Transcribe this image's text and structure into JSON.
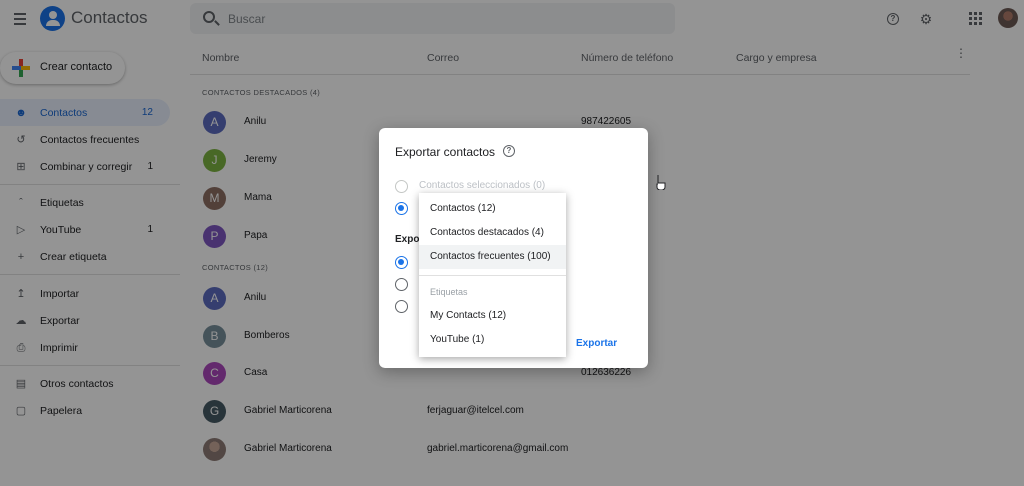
{
  "app": {
    "title": "Contactos"
  },
  "search": {
    "placeholder": "Buscar"
  },
  "sidebar": {
    "create_label": "Crear contacto",
    "items": [
      {
        "label": "Contactos",
        "count": "12"
      },
      {
        "label": "Contactos frecuentes",
        "count": ""
      },
      {
        "label": "Combinar y corregir",
        "count": "1"
      },
      {
        "label": "Etiquetas",
        "count": ""
      },
      {
        "label": "YouTube",
        "count": "1"
      },
      {
        "label": "Crear etiqueta",
        "count": ""
      },
      {
        "label": "Importar",
        "count": ""
      },
      {
        "label": "Exportar",
        "count": ""
      },
      {
        "label": "Imprimir",
        "count": ""
      },
      {
        "label": "Otros contactos",
        "count": ""
      },
      {
        "label": "Papelera",
        "count": ""
      }
    ]
  },
  "table": {
    "headers": [
      "Nombre",
      "Correo",
      "Número de teléfono",
      "Cargo y empresa"
    ],
    "starred_label": "CONTACTOS DESTACADOS (4)",
    "contacts_label": "CONTACTOS (12)",
    "starred": [
      {
        "initial": "A",
        "name": "Anilu",
        "email": "",
        "phone": "987422605",
        "color": "#5c6bc0"
      },
      {
        "initial": "J",
        "name": "Jeremy",
        "email": "",
        "phone": "",
        "color": "#7cb342"
      },
      {
        "initial": "M",
        "name": "Mama",
        "email": "",
        "phone": "",
        "color": "#8d6e63"
      },
      {
        "initial": "P",
        "name": "Papa",
        "email": "",
        "phone": "",
        "color": "#7e57c2"
      }
    ],
    "contacts": [
      {
        "initial": "A",
        "name": "Anilu",
        "email": "",
        "phone": "",
        "color": "#5c6bc0"
      },
      {
        "initial": "B",
        "name": "Bomberos",
        "email": "",
        "phone": "",
        "color": "#78909c"
      },
      {
        "initial": "C",
        "name": "Casa",
        "email": "",
        "phone": "012636226",
        "color": "#ab47bc"
      },
      {
        "initial": "G",
        "name": "Gabriel Marticorena",
        "email": "ferjaguar@itelcel.com",
        "phone": "",
        "color": "#455a64"
      },
      {
        "initial": "",
        "name": "Gabriel Marticorena",
        "email": "gabriel.marticorena@gmail.com",
        "phone": "",
        "color": "#8d7b75"
      }
    ]
  },
  "dialog": {
    "title": "Exportar contactos",
    "option_selected": "Contactos seleccionados (0)",
    "section_label": "Expor",
    "export_button": "Exportar"
  },
  "dropdown": {
    "items": [
      "Contactos (12)",
      "Contactos destacados (4)",
      "Contactos frecuentes (100)"
    ],
    "labels_header": "Etiquetas",
    "label_items": [
      "My Contacts (12)",
      "YouTube (1)"
    ]
  },
  "colors": {
    "accent": "#1a73e8",
    "active_bg": "#e8f0fe"
  }
}
